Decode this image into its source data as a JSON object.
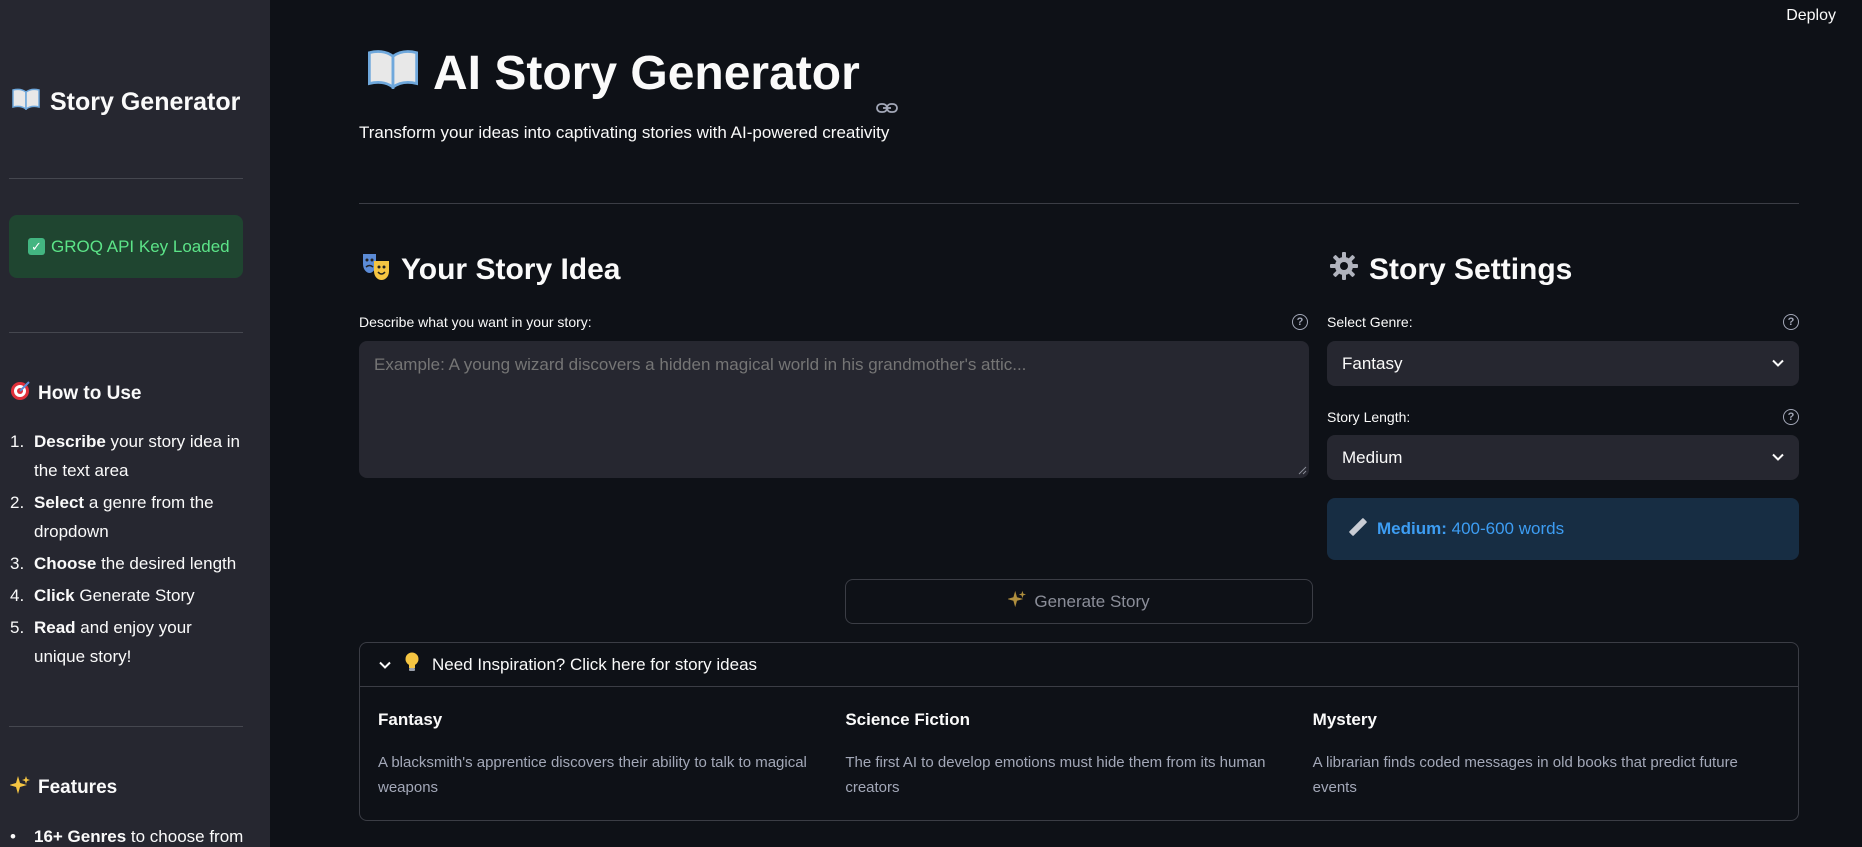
{
  "topbar": {
    "deploy_label": "Deploy"
  },
  "sidebar": {
    "title": "Story Generator",
    "title_icon": "open-book-icon",
    "api_status": "GROQ API Key Loaded",
    "how_to": {
      "heading": "How to Use",
      "icon": "target-icon",
      "steps": [
        {
          "num": "1.",
          "bold": "Describe",
          "text": " your story idea in the text area"
        },
        {
          "num": "2.",
          "bold": "Select",
          "text": " a genre from the dropdown"
        },
        {
          "num": "3.",
          "bold": "Choose",
          "text": " the desired length"
        },
        {
          "num": "4.",
          "bold": "Click",
          "text": " Generate Story"
        },
        {
          "num": "5.",
          "bold": "Read",
          "text": " and enjoy your unique story!"
        }
      ]
    },
    "features": {
      "heading": "Features",
      "icon": "sparkles-icon",
      "items": [
        {
          "bold": "16+ Genres",
          "text": " to choose from"
        }
      ]
    }
  },
  "header": {
    "title": "AI Story Generator",
    "subtitle": "Transform your ideas into captivating stories with AI-powered creativity"
  },
  "story_idea": {
    "heading": "Your Story Idea",
    "label": "Describe what you want in your story:",
    "placeholder": "Example: A young wizard discovers a hidden magical world in his grandmother's attic..."
  },
  "settings": {
    "heading": "Story Settings",
    "genre_label": "Select Genre:",
    "genre_value": "Fantasy",
    "length_label": "Story Length:",
    "length_value": "Medium",
    "info_bold": "Medium:",
    "info_text": " 400-600 words"
  },
  "generate_button": "Generate Story",
  "inspiration": {
    "header": "Need Inspiration? Click here for story ideas",
    "ideas": [
      {
        "genre": "Fantasy",
        "text": "A blacksmith's apprentice discovers their ability to talk to magical weapons"
      },
      {
        "genre": "Science Fiction",
        "text": "The first AI to develop emotions must hide them from its human creators"
      },
      {
        "genre": "Mystery",
        "text": "A librarian finds coded messages in old books that predict future events"
      }
    ]
  },
  "colors": {
    "background": "#0e1117",
    "sidebar": "#262730",
    "success_bg": "#1f4530",
    "success_text": "#5ce488",
    "info_bg": "#172d43",
    "info_text": "#3d9df3"
  }
}
